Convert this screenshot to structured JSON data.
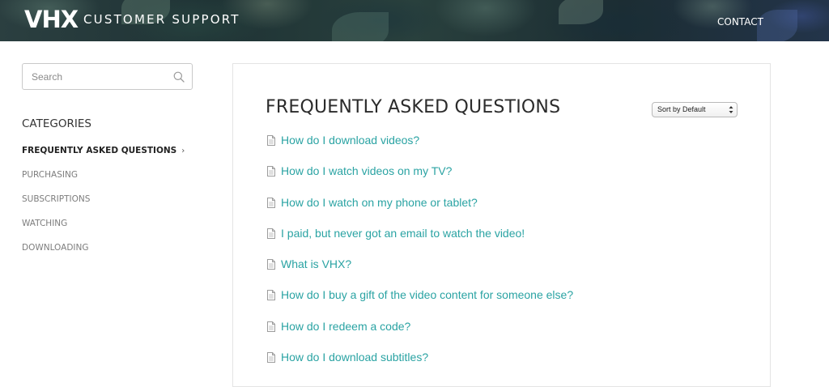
{
  "header": {
    "logo": "VHX",
    "subtitle": "CUSTOMER SUPPORT",
    "contact": "CONTACT"
  },
  "sidebar": {
    "search": {
      "placeholder": "Search",
      "icon": "search-icon"
    },
    "categories_title": "CATEGORIES",
    "categories": [
      {
        "label": "FREQUENTLY ASKED QUESTIONS",
        "active": true
      },
      {
        "label": "PURCHASING",
        "active": false
      },
      {
        "label": "SUBSCRIPTIONS",
        "active": false
      },
      {
        "label": "WATCHING",
        "active": false
      },
      {
        "label": "DOWNLOADING",
        "active": false
      }
    ]
  },
  "main": {
    "title": "FREQUENTLY ASKED QUESTIONS",
    "sort": {
      "selected": "Sort by Default"
    },
    "articles": [
      {
        "label": "How do I download videos?",
        "icon": "document-icon"
      },
      {
        "label": "How do I watch videos on my TV?",
        "icon": "document-icon"
      },
      {
        "label": "How do I watch on my phone or tablet?",
        "icon": "document-icon"
      },
      {
        "label": "I paid, but never got an email to watch the video!",
        "icon": "document-icon"
      },
      {
        "label": "What is VHX?",
        "icon": "document-icon"
      },
      {
        "label": "How do I buy a gift of the video content for someone else?",
        "icon": "document-icon"
      },
      {
        "label": "How do I redeem a code?",
        "icon": "document-icon"
      },
      {
        "label": "How do I download subtitles?",
        "icon": "document-icon"
      }
    ]
  },
  "colors": {
    "link": "#2aa3a3",
    "header_bg": "#1f3335",
    "text_dark": "#2b2b2b",
    "text_muted": "#7d7d7d"
  }
}
